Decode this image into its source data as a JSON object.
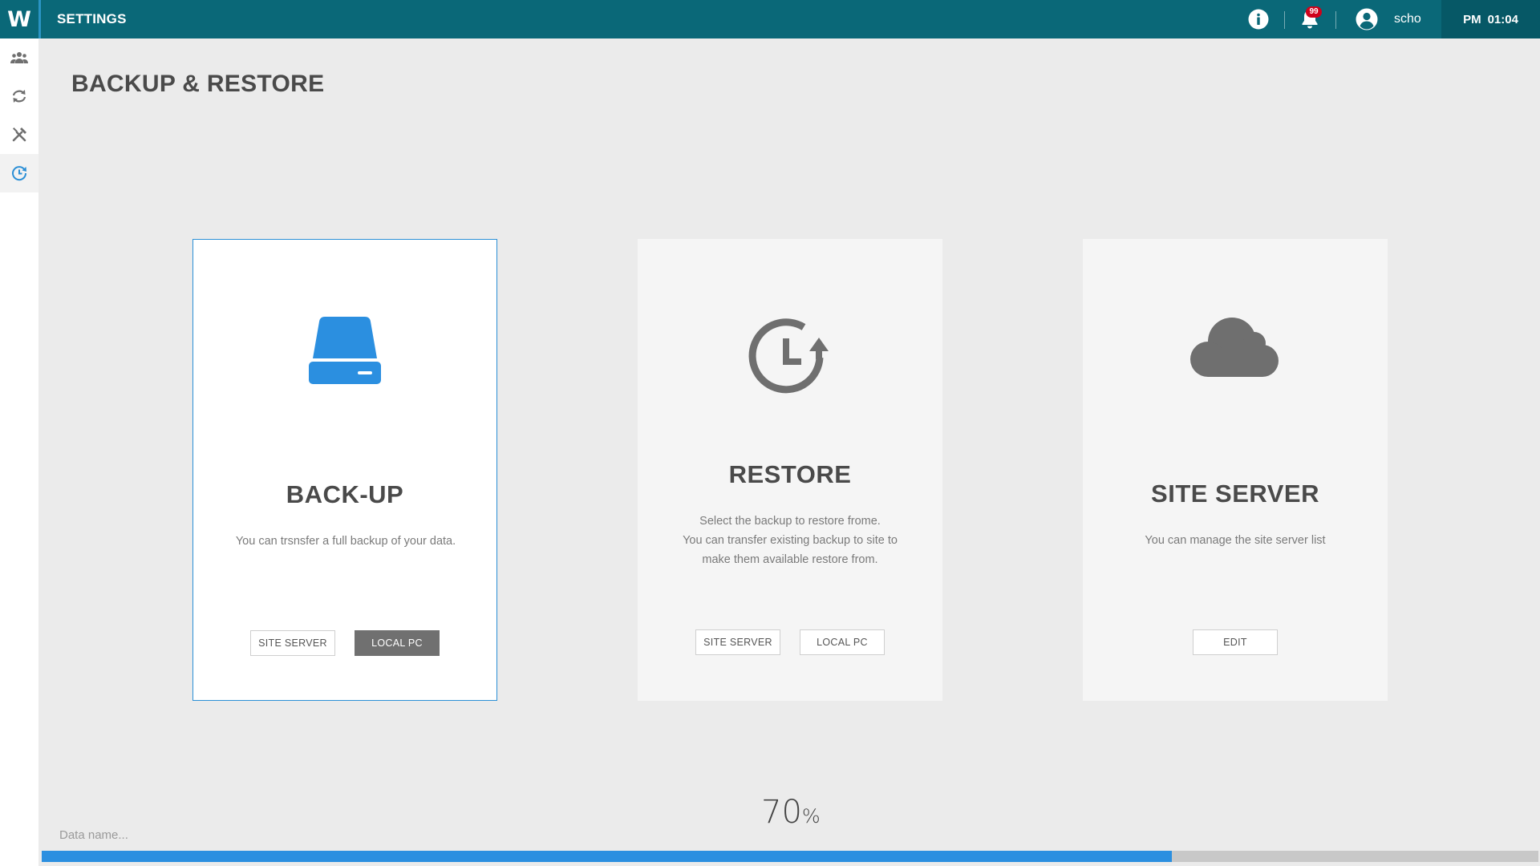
{
  "header": {
    "logo": "W",
    "title": "SETTINGS",
    "notification_count": "99",
    "username": "scho",
    "clock": {
      "ampm": "PM",
      "time": "01:04"
    }
  },
  "sidebar": {
    "items": [
      {
        "icon": "users-icon"
      },
      {
        "icon": "sync-icon"
      },
      {
        "icon": "tools-icon"
      },
      {
        "icon": "backup-restore-icon",
        "active": true
      }
    ]
  },
  "page": {
    "title": "BACKUP & RESTORE"
  },
  "cards": {
    "backup": {
      "icon": "hard-drive-icon",
      "title": "BACK-UP",
      "description": "You can trsnsfer a full backup of your data.",
      "buttons": [
        "SITE SERVER",
        "LOCAL PC"
      ]
    },
    "restore": {
      "icon": "restore-clock-icon",
      "title": "RESTORE",
      "description_lines": [
        "Select the backup to restore frome.",
        "You can transfer existing backup to site to",
        "make them available restore from."
      ],
      "buttons": [
        "SITE SERVER",
        "LOCAL PC"
      ]
    },
    "site_server": {
      "icon": "cloud-icon",
      "title": "SITE SERVER",
      "description": "You can manage the site server list",
      "buttons": [
        "EDIT"
      ]
    }
  },
  "progress": {
    "value": "70",
    "unit": "%",
    "fraction": 0.755,
    "data_name_placeholder": "Data name..."
  },
  "colors": {
    "header_bg": "#0a6878",
    "accent_blue": "#2b8fe0",
    "badge_red": "#d0021b",
    "icon_gray": "#6f6f6f"
  }
}
